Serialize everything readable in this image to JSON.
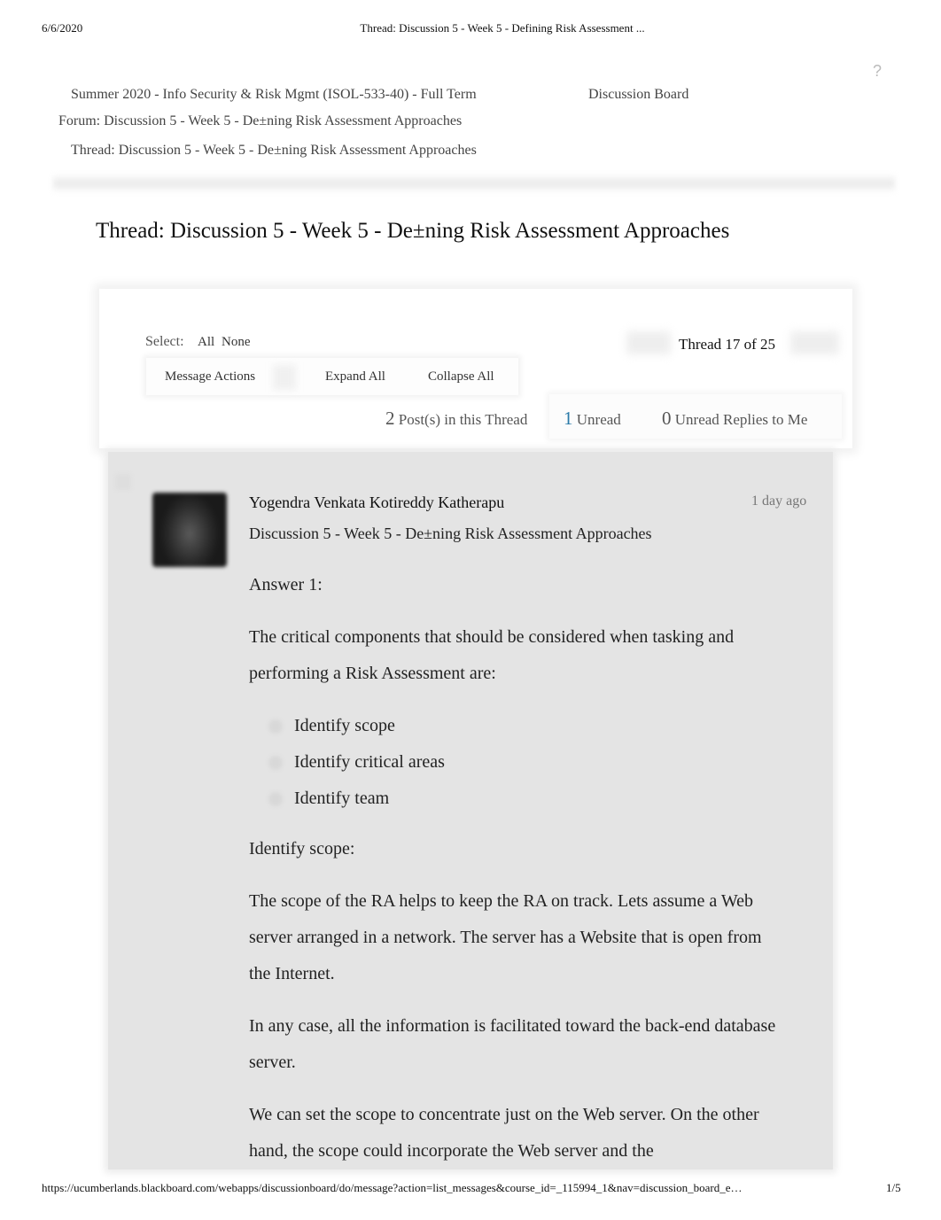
{
  "print_header": {
    "date": "6/6/2020",
    "title": "Thread: Discussion 5 - Week 5 - Defining Risk Assessment ..."
  },
  "help_icon": "?",
  "breadcrumb": {
    "course": "Summer 2020 - Info Security & Risk Mgmt (ISOL-533-40) - Full Term",
    "board": "Discussion Board",
    "forum": "Forum: Discussion 5 - Week 5 - De±ning Risk Assessment Approaches",
    "thread": "Thread: Discussion 5 - Week 5 - De±ning Risk Assessment Approaches"
  },
  "page_title": "Thread: Discussion 5 - Week 5 - De±ning Risk Assessment Approaches",
  "toolbar": {
    "select_label": "Select:",
    "select_all": "All",
    "select_none": "None",
    "message_actions": "Message Actions",
    "expand_all": "Expand All",
    "collapse_all": "Collapse All",
    "thread_position": "Thread 17 of 25"
  },
  "stats": {
    "posts_count": "2",
    "posts_label": "Post(s) in this Thread",
    "unread_count": "1",
    "unread_label": "Unread",
    "replies_count": "0",
    "replies_label": "Unread Replies to Me",
    "unread_color": "#2a7aa8"
  },
  "post": {
    "author": "Yogendra Venkata Kotireddy Katherapu",
    "timestamp": "1 day ago",
    "subject": "Discussion 5 - Week 5 - De±ning Risk Assessment Approaches",
    "body": {
      "heading1": "Answer 1:",
      "intro": "The critical components that should be considered when tasking and performing a Risk Assessment are:",
      "list": [
        "Identify scope",
        "Identify critical areas",
        "Identify team"
      ],
      "heading2": "Identify scope:",
      "para1": "The scope of the RA helps to keep the RA on track. Lets assume a Web server arranged in a network. The server has a Website that is open from the Internet.",
      "para2": "In any case, all the information is facilitated toward the back-end database server.",
      "para3": "We can set the scope to concentrate just on the Web server. On the other hand, the scope could incorporate the Web server and the"
    }
  },
  "print_footer": {
    "url": "https://ucumberlands.blackboard.com/webapps/discussionboard/do/message?action=list_messages&course_id=_115994_1&nav=discussion_board_e…",
    "page": "1/5"
  }
}
